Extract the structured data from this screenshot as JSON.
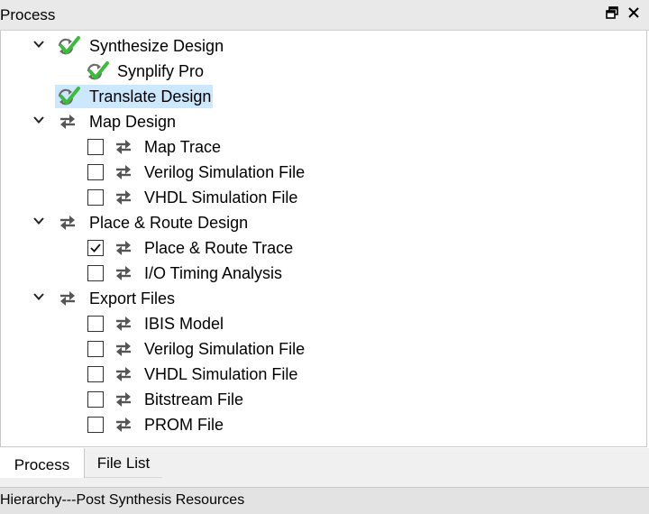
{
  "panel": {
    "title": "Process",
    "restore_icon": "restore-window-icon",
    "close_icon": "close-icon"
  },
  "colors": {
    "selection": "#cce8ff",
    "done_check": "#3dbb3d",
    "refresh": "#555555"
  },
  "tree": [
    {
      "label": "Synthesize Design",
      "level": 0,
      "expandable": true,
      "expanded": true,
      "status": "done",
      "checkbox": null,
      "selected": false
    },
    {
      "label": "Synplify Pro",
      "level": 1,
      "expandable": false,
      "status": "done",
      "checkbox": null,
      "selected": false
    },
    {
      "label": "Translate Design",
      "level": 0,
      "expandable": false,
      "status": "done",
      "checkbox": null,
      "selected": true
    },
    {
      "label": "Map Design",
      "level": 0,
      "expandable": true,
      "expanded": true,
      "status": "pending",
      "checkbox": null,
      "selected": false
    },
    {
      "label": "Map Trace",
      "level": 1,
      "expandable": false,
      "status": "pending",
      "checkbox": false,
      "selected": false
    },
    {
      "label": "Verilog Simulation File",
      "level": 1,
      "expandable": false,
      "status": "pending",
      "checkbox": false,
      "selected": false
    },
    {
      "label": "VHDL Simulation File",
      "level": 1,
      "expandable": false,
      "status": "pending",
      "checkbox": false,
      "selected": false
    },
    {
      "label": "Place & Route Design",
      "level": 0,
      "expandable": true,
      "expanded": true,
      "status": "pending",
      "checkbox": null,
      "selected": false
    },
    {
      "label": "Place & Route Trace",
      "level": 1,
      "expandable": false,
      "status": "pending",
      "checkbox": true,
      "selected": false
    },
    {
      "label": "I/O Timing Analysis",
      "level": 1,
      "expandable": false,
      "status": "pending",
      "checkbox": false,
      "selected": false
    },
    {
      "label": "Export Files",
      "level": 0,
      "expandable": true,
      "expanded": true,
      "status": "pending",
      "checkbox": null,
      "selected": false
    },
    {
      "label": "IBIS Model",
      "level": 1,
      "expandable": false,
      "status": "pending",
      "checkbox": false,
      "selected": false
    },
    {
      "label": "Verilog Simulation File",
      "level": 1,
      "expandable": false,
      "status": "pending",
      "checkbox": false,
      "selected": false
    },
    {
      "label": "VHDL Simulation File",
      "level": 1,
      "expandable": false,
      "status": "pending",
      "checkbox": false,
      "selected": false
    },
    {
      "label": "Bitstream File",
      "level": 1,
      "expandable": false,
      "status": "pending",
      "checkbox": false,
      "selected": false
    },
    {
      "label": "PROM File",
      "level": 1,
      "expandable": false,
      "status": "pending",
      "checkbox": false,
      "selected": false
    }
  ],
  "tabs": [
    {
      "label": "Process",
      "active": true
    },
    {
      "label": "File List",
      "active": false
    }
  ],
  "bottom_panel": {
    "title": "Hierarchy---Post Synthesis Resources"
  }
}
